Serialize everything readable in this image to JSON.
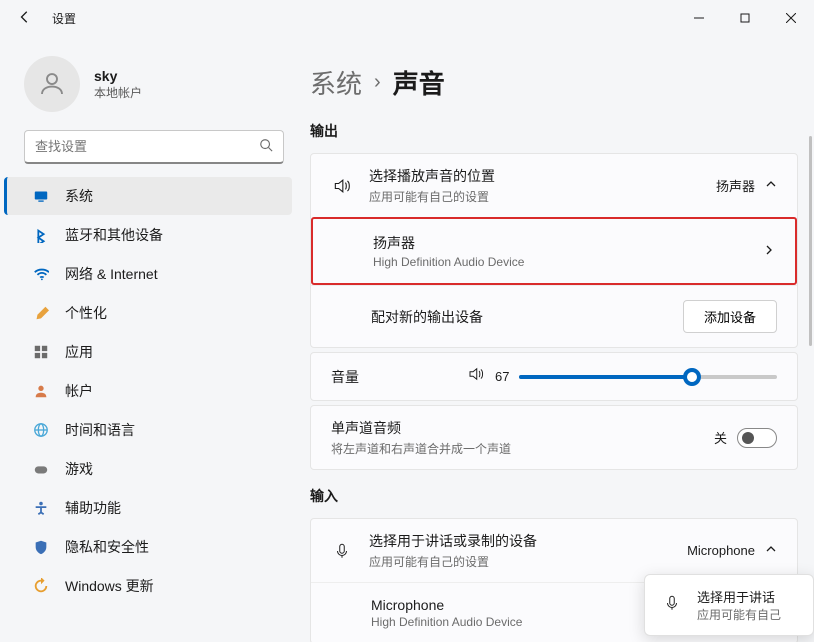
{
  "window": {
    "title": "设置"
  },
  "user": {
    "name": "sky",
    "sub": "本地帐户"
  },
  "search": {
    "placeholder": "查找设置"
  },
  "nav": [
    {
      "label": "系统",
      "icon": "system",
      "color": "#0067c0"
    },
    {
      "label": "蓝牙和其他设备",
      "icon": "bluetooth",
      "color": "#0067c0"
    },
    {
      "label": "网络 & Internet",
      "icon": "wifi",
      "color": "#0067c0"
    },
    {
      "label": "个性化",
      "icon": "brush",
      "color": "#e8a23d"
    },
    {
      "label": "应用",
      "icon": "apps",
      "color": "#6b6b6b"
    },
    {
      "label": "帐户",
      "icon": "person",
      "color": "#d77b4a"
    },
    {
      "label": "时间和语言",
      "icon": "globe",
      "color": "#4aa8d8"
    },
    {
      "label": "游戏",
      "icon": "gamepad",
      "color": "#7a7a7a"
    },
    {
      "label": "辅助功能",
      "icon": "accessibility",
      "color": "#3b6fb6"
    },
    {
      "label": "隐私和安全性",
      "icon": "shield",
      "color": "#3b6fb6"
    },
    {
      "label": "Windows 更新",
      "icon": "update",
      "color": "#e79e2f"
    }
  ],
  "breadcrumb": {
    "parent": "系统",
    "current": "声音"
  },
  "sections": {
    "output_heading": "输出",
    "input_heading": "输入",
    "output_choose": {
      "title": "选择播放声音的位置",
      "sub": "应用可能有自己的设置",
      "value": "扬声器"
    },
    "speaker": {
      "title": "扬声器",
      "sub": "High Definition Audio Device"
    },
    "pair": {
      "title": "配对新的输出设备",
      "button": "添加设备"
    },
    "volume": {
      "label": "音量",
      "value": 67
    },
    "mono": {
      "title": "单声道音频",
      "sub": "将左声道和右声道合并成一个声道",
      "state": "关"
    },
    "input_choose": {
      "title": "选择用于讲话或录制的设备",
      "sub": "应用可能有自己的设置",
      "value": "Microphone"
    },
    "microphone": {
      "title": "Microphone",
      "sub": "High Definition Audio Device"
    }
  },
  "toast": {
    "title": "选择用于讲话",
    "sub": "应用可能有自己"
  }
}
